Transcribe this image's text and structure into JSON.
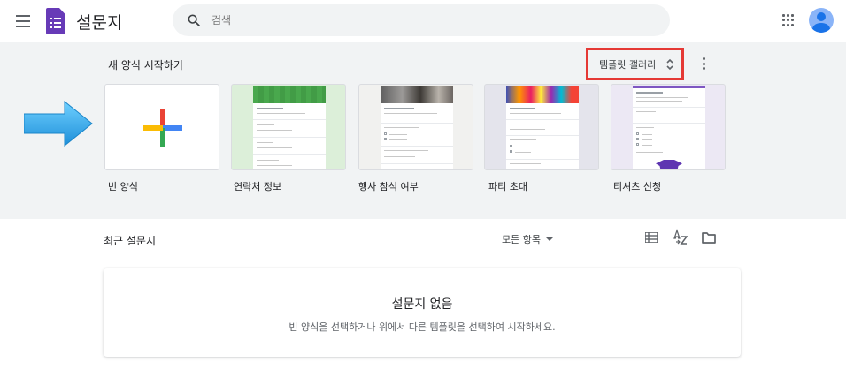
{
  "header": {
    "app_title": "설문지",
    "search_placeholder": "검색"
  },
  "templates": {
    "section_title": "새 양식 시작하기",
    "gallery_label": "템플릿 갤러리",
    "items": [
      {
        "label": "빈 양식"
      },
      {
        "label": "연락처 정보"
      },
      {
        "label": "행사 참석 여부"
      },
      {
        "label": "파티 초대"
      },
      {
        "label": "티셔츠 신청"
      }
    ]
  },
  "recent": {
    "title": "최근 설문지",
    "owner_filter": "모든 항목",
    "empty_title": "설문지 없음",
    "empty_description": "빈 양식을 선택하거나 위에서 다른 템플릿을 선택하여 시작하세요."
  },
  "colors": {
    "brand_purple": "#673ab7",
    "highlight_red": "#e53935",
    "arrow_blue": "#29a3e6",
    "band_bg": "#f1f3f4"
  }
}
